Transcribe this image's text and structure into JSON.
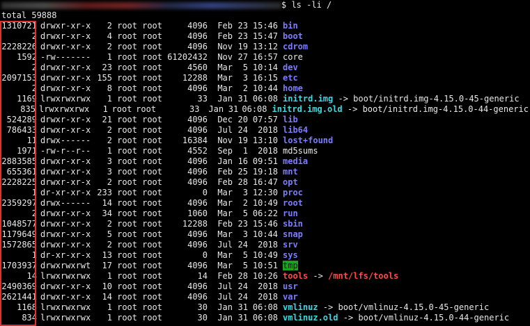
{
  "prompt": {
    "command": "$ ls -li /"
  },
  "total_line": "total 59888",
  "rows": [
    {
      "inode": "1310721",
      "perm": "drwxr-xr-x",
      "links": "2",
      "owner": "root",
      "group": "root",
      "size": "4096",
      "mon": "Feb",
      "day": "23",
      "time": "15:46",
      "name": "bin",
      "type": "dir",
      "arrow": "",
      "target": "",
      "target_type": "file"
    },
    {
      "inode": "2",
      "perm": "drwxr-xr-x",
      "links": "4",
      "owner": "root",
      "group": "root",
      "size": "4096",
      "mon": "Feb",
      "day": "23",
      "time": "15:47",
      "name": "boot",
      "type": "dir",
      "arrow": "",
      "target": "",
      "target_type": "file"
    },
    {
      "inode": "2228226",
      "perm": "drwxr-xr-x",
      "links": "2",
      "owner": "root",
      "group": "root",
      "size": "4096",
      "mon": "Nov",
      "day": "19",
      "time": "13:12",
      "name": "cdrom",
      "type": "dir",
      "arrow": "",
      "target": "",
      "target_type": "file"
    },
    {
      "inode": "1592",
      "perm": "-rw-------",
      "links": "1",
      "owner": "root",
      "group": "root",
      "size": "61202432",
      "mon": "Nov",
      "day": "27",
      "time": "16:57",
      "name": "core",
      "type": "file",
      "arrow": "",
      "target": "",
      "target_type": "file"
    },
    {
      "inode": "2",
      "perm": "drwxr-xr-x",
      "links": "23",
      "owner": "root",
      "group": "root",
      "size": "4560",
      "mon": "Mar",
      "day": "5",
      "time": "10:14",
      "name": "dev",
      "type": "dir",
      "arrow": "",
      "target": "",
      "target_type": "file"
    },
    {
      "inode": "2097153",
      "perm": "drwxr-xr-x",
      "links": "155",
      "owner": "root",
      "group": "root",
      "size": "12288",
      "mon": "Mar",
      "day": "3",
      "time": "16:15",
      "name": "etc",
      "type": "dir",
      "arrow": "",
      "target": "",
      "target_type": "file"
    },
    {
      "inode": "2",
      "perm": "drwxr-xr-x",
      "links": "8",
      "owner": "root",
      "group": "root",
      "size": "4096",
      "mon": "Mar",
      "day": "2",
      "time": "10:44",
      "name": "home",
      "type": "dir",
      "arrow": "",
      "target": "",
      "target_type": "file"
    },
    {
      "inode": "1169",
      "perm": "lrwxrwxrwx",
      "links": "1",
      "owner": "root",
      "group": "root",
      "size": "33",
      "mon": "Jan",
      "day": "31",
      "time": "06:08",
      "name": "initrd.img",
      "type": "link",
      "arrow": " -> ",
      "target": "boot/initrd.img-4.15.0-45-generic",
      "target_type": "file"
    },
    {
      "inode": "835",
      "perm": "lrwxrwxrwx",
      "links": "1",
      "owner": "root",
      "group": "root",
      "size": "33",
      "mon": "Jan",
      "day": "31",
      "time": "06:08",
      "name": "initrd.img.old",
      "type": "link",
      "arrow": " -> ",
      "target": "boot/initrd.img-4.15.0-44-generic",
      "target_type": "file"
    },
    {
      "inode": "524289",
      "perm": "drwxr-xr-x",
      "links": "21",
      "owner": "root",
      "group": "root",
      "size": "4096",
      "mon": "Dec",
      "day": "20",
      "time": "07:57",
      "name": "lib",
      "type": "dir",
      "arrow": "",
      "target": "",
      "target_type": "file"
    },
    {
      "inode": "786433",
      "perm": "drwxr-xr-x",
      "links": "2",
      "owner": "root",
      "group": "root",
      "size": "4096",
      "mon": "Jul",
      "day": "24",
      "time": "2018",
      "name": "lib64",
      "type": "dir",
      "arrow": "",
      "target": "",
      "target_type": "file"
    },
    {
      "inode": "11",
      "perm": "drwx------",
      "links": "2",
      "owner": "root",
      "group": "root",
      "size": "16384",
      "mon": "Nov",
      "day": "19",
      "time": "13:10",
      "name": "lost+found",
      "type": "dir",
      "arrow": "",
      "target": "",
      "target_type": "file"
    },
    {
      "inode": "1971",
      "perm": "-rw-r--r--",
      "links": "1",
      "owner": "root",
      "group": "root",
      "size": "4552",
      "mon": "Sep",
      "day": "1",
      "time": "2018",
      "name": "md5sums",
      "type": "file",
      "arrow": "",
      "target": "",
      "target_type": "file"
    },
    {
      "inode": "2883585",
      "perm": "drwxr-xr-x",
      "links": "3",
      "owner": "root",
      "group": "root",
      "size": "4096",
      "mon": "Jan",
      "day": "16",
      "time": "09:51",
      "name": "media",
      "type": "dir",
      "arrow": "",
      "target": "",
      "target_type": "file"
    },
    {
      "inode": "655361",
      "perm": "drwxr-xr-x",
      "links": "3",
      "owner": "root",
      "group": "root",
      "size": "4096",
      "mon": "Feb",
      "day": "25",
      "time": "19:18",
      "name": "mnt",
      "type": "dir",
      "arrow": "",
      "target": "",
      "target_type": "file"
    },
    {
      "inode": "2228225",
      "perm": "drwxr-xr-x",
      "links": "2",
      "owner": "root",
      "group": "root",
      "size": "4096",
      "mon": "Feb",
      "day": "28",
      "time": "16:47",
      "name": "opt",
      "type": "dir",
      "arrow": "",
      "target": "",
      "target_type": "file"
    },
    {
      "inode": "1",
      "perm": "dr-xr-xr-x",
      "links": "233",
      "owner": "root",
      "group": "root",
      "size": "0",
      "mon": "Mar",
      "day": "3",
      "time": "12:30",
      "name": "proc",
      "type": "dir",
      "arrow": "",
      "target": "",
      "target_type": "file"
    },
    {
      "inode": "2359297",
      "perm": "drwx------",
      "links": "14",
      "owner": "root",
      "group": "root",
      "size": "4096",
      "mon": "Mar",
      "day": "2",
      "time": "10:49",
      "name": "root",
      "type": "dir",
      "arrow": "",
      "target": "",
      "target_type": "file"
    },
    {
      "inode": "2",
      "perm": "drwxr-xr-x",
      "links": "34",
      "owner": "root",
      "group": "root",
      "size": "1060",
      "mon": "Mar",
      "day": "5",
      "time": "06:22",
      "name": "run",
      "type": "dir",
      "arrow": "",
      "target": "",
      "target_type": "file"
    },
    {
      "inode": "1048577",
      "perm": "drwxr-xr-x",
      "links": "2",
      "owner": "root",
      "group": "root",
      "size": "12288",
      "mon": "Feb",
      "day": "23",
      "time": "15:46",
      "name": "sbin",
      "type": "dir",
      "arrow": "",
      "target": "",
      "target_type": "file"
    },
    {
      "inode": "1179649",
      "perm": "drwxr-xr-x",
      "links": "5",
      "owner": "root",
      "group": "root",
      "size": "4096",
      "mon": "Mar",
      "day": "3",
      "time": "10:44",
      "name": "snap",
      "type": "dir",
      "arrow": "",
      "target": "",
      "target_type": "file"
    },
    {
      "inode": "1572865",
      "perm": "drwxr-xr-x",
      "links": "2",
      "owner": "root",
      "group": "root",
      "size": "4096",
      "mon": "Jul",
      "day": "24",
      "time": "2018",
      "name": "srv",
      "type": "dir",
      "arrow": "",
      "target": "",
      "target_type": "file"
    },
    {
      "inode": "1",
      "perm": "dr-xr-xr-x",
      "links": "13",
      "owner": "root",
      "group": "root",
      "size": "0",
      "mon": "Mar",
      "day": "5",
      "time": "10:49",
      "name": "sys",
      "type": "dir",
      "arrow": "",
      "target": "",
      "target_type": "file"
    },
    {
      "inode": "1703937",
      "perm": "drwxrwxrwt",
      "links": "17",
      "owner": "root",
      "group": "root",
      "size": "4096",
      "mon": "Mar",
      "day": "5",
      "time": "10:51",
      "name": "tmp",
      "type": "sticky",
      "arrow": "",
      "target": "",
      "target_type": "file"
    },
    {
      "inode": "14",
      "perm": "lrwxrwxrwx",
      "links": "1",
      "owner": "root",
      "group": "root",
      "size": "14",
      "mon": "Feb",
      "day": "28",
      "time": "10:26",
      "name": "tools",
      "type": "broken",
      "arrow": " -> ",
      "target": "/mnt/lfs/tools",
      "target_type": "broken"
    },
    {
      "inode": "2490369",
      "perm": "drwxr-xr-x",
      "links": "10",
      "owner": "root",
      "group": "root",
      "size": "4096",
      "mon": "Jul",
      "day": "24",
      "time": "2018",
      "name": "usr",
      "type": "dir",
      "arrow": "",
      "target": "",
      "target_type": "file"
    },
    {
      "inode": "2621441",
      "perm": "drwxr-xr-x",
      "links": "14",
      "owner": "root",
      "group": "root",
      "size": "4096",
      "mon": "Jul",
      "day": "24",
      "time": "2018",
      "name": "var",
      "type": "dir",
      "arrow": "",
      "target": "",
      "target_type": "file"
    },
    {
      "inode": "1168",
      "perm": "lrwxrwxrwx",
      "links": "1",
      "owner": "root",
      "group": "root",
      "size": "30",
      "mon": "Jan",
      "day": "31",
      "time": "06:08",
      "name": "vmlinuz",
      "type": "link",
      "arrow": " -> ",
      "target": "boot/vmlinuz-4.15.0-45-generic",
      "target_type": "file"
    },
    {
      "inode": "834",
      "perm": "lrwxrwxrwx",
      "links": "1",
      "owner": "root",
      "group": "root",
      "size": "30",
      "mon": "Jan",
      "day": "31",
      "time": "06:08",
      "name": "vmlinuz.old",
      "type": "link",
      "arrow": " -> ",
      "target": "boot/vmlinuz-4.15.0-44-generic",
      "target_type": "file"
    }
  ]
}
